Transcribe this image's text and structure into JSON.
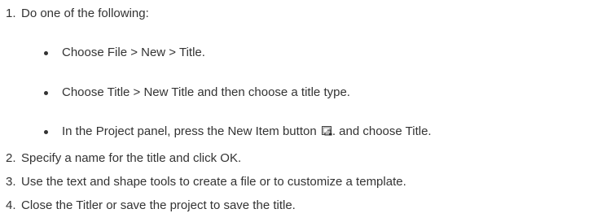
{
  "steps": [
    {
      "number": "1.",
      "text": "Do one of the following:"
    },
    {
      "number": "2.",
      "text": "Specify a name for the title and click OK."
    },
    {
      "number": "3.",
      "text": "Use the text and shape tools to create a file or to customize a template."
    },
    {
      "number": "4.",
      "text": "Close the Titler or save the project to save the title."
    }
  ],
  "options": [
    {
      "text": "Choose File > New > Title."
    },
    {
      "text": "Choose Title > New Title and then choose a title type."
    },
    {
      "text_before_icon": "In the Project panel, press the New Item button",
      "icon": "new-item-icon",
      "text_after_icon": ". and choose Title."
    }
  ]
}
